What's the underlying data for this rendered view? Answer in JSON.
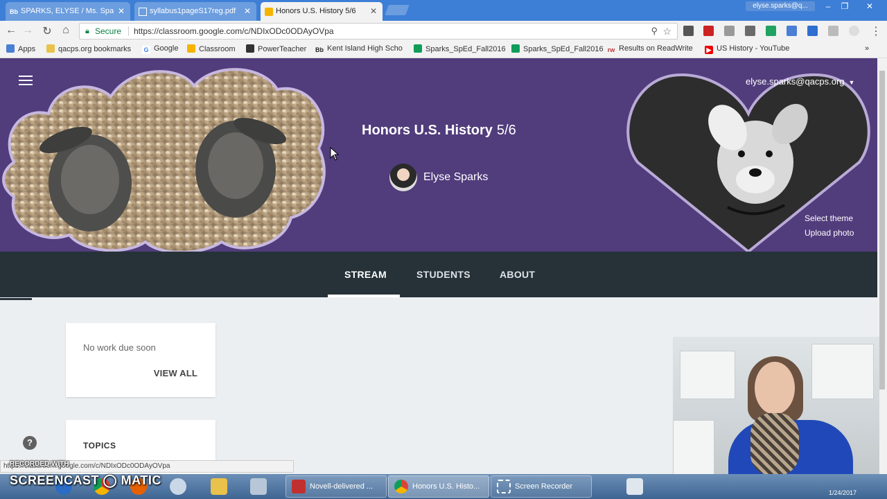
{
  "browser": {
    "tabs": [
      {
        "label": "SPARKS, ELYSE / Ms. Spa",
        "icon": "blackboard-icon"
      },
      {
        "label": "syllabus1pageS17reg.pdf",
        "icon": "document-icon"
      },
      {
        "label": "Honors U.S. History 5/6",
        "icon": "classroom-icon",
        "active": true
      }
    ],
    "profile_label": "elyse.sparks@q...",
    "url_secure_label": "Secure",
    "url": "https://classroom.google.com/c/NDIxODc0ODAyOVpa",
    "bookmarks": [
      {
        "label": "Apps",
        "icon": "apps-grid-icon"
      },
      {
        "label": "qacps.org bookmarks",
        "icon": "folder-icon"
      },
      {
        "label": "Google",
        "icon": "google-icon"
      },
      {
        "label": "Classroom",
        "icon": "classroom-icon"
      },
      {
        "label": "PowerTeacher",
        "icon": "powerteacher-icon"
      },
      {
        "label": "Kent Island High Scho",
        "icon": "blackboard-icon"
      },
      {
        "label": "Sparks_SpEd_Fall2016",
        "icon": "sheets-icon"
      },
      {
        "label": "Sparks_SpEd_Fall2016",
        "icon": "sheets-icon"
      },
      {
        "label": "Results on ReadWrite",
        "icon": "readwrite-icon"
      },
      {
        "label": "US History - YouTube",
        "icon": "youtube-icon"
      }
    ]
  },
  "classroom": {
    "course_title": "Honors U.S. History",
    "course_section": "5/6",
    "teacher_name": "Elyse Sparks",
    "account_email": "elyse.sparks@qacps.org",
    "select_theme": "Select theme",
    "upload_photo": "Upload photo",
    "tabs": {
      "stream": "STREAM",
      "students": "STUDENTS",
      "about": "ABOUT"
    },
    "upcoming_card": {
      "empty_text": "No work due soon",
      "view_all": "VIEW ALL"
    },
    "topics_heading": "TOPICS",
    "help_glyph": "?"
  },
  "status_url": "https://classroom.google.com/c/NDIxODc0ODAyOVpa",
  "watermark": {
    "small": "RECORDED WITH",
    "big": "SCREENCAST ◯ MATIC"
  },
  "taskbar": {
    "tasks": [
      {
        "label": "Novell-delivered ..."
      },
      {
        "label": "Honors U.S. Histo..."
      },
      {
        "label": "Screen Recorder"
      }
    ],
    "date": "1/24/2017"
  },
  "colors": {
    "hero": "#513c7c",
    "tabs_bar": "#263238",
    "chrome_blue": "#3d7ed6"
  }
}
